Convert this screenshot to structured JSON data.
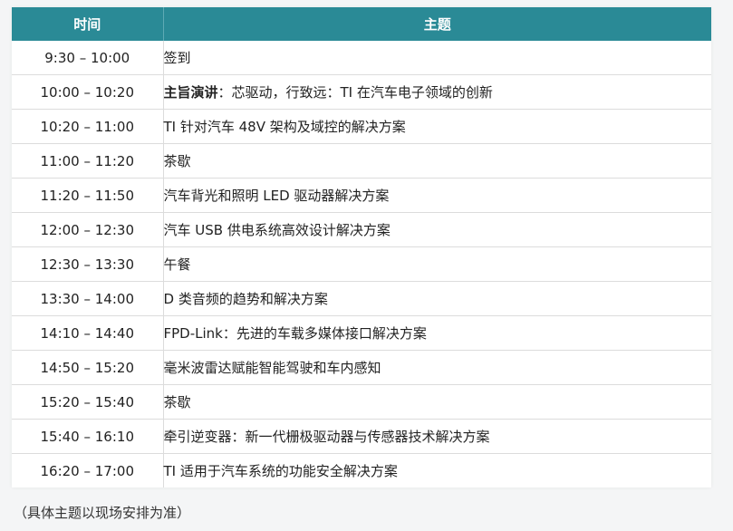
{
  "table": {
    "header": {
      "time": "时间",
      "topic": "主题"
    },
    "rows": [
      {
        "time": "9:30 – 10:00",
        "topic": "签到"
      },
      {
        "time": "10:00 – 10:20",
        "topic_bold": "主旨演讲",
        "topic": "：芯驱动，行致远：TI 在汽车电子领域的创新"
      },
      {
        "time": "10:20 – 11:00",
        "topic": "TI 针对汽车 48V 架构及域控的解决方案"
      },
      {
        "time": "11:00 – 11:20",
        "topic": "茶歇"
      },
      {
        "time": "11:20 – 11:50",
        "topic": "汽车背光和照明 LED 驱动器解决方案"
      },
      {
        "time": "12:00 – 12:30",
        "topic": "汽车 USB 供电系统高效设计解决方案"
      },
      {
        "time": "12:30 – 13:30",
        "topic": "午餐"
      },
      {
        "time": "13:30 – 14:00",
        "topic": "D 类音频的趋势和解决方案"
      },
      {
        "time": "14:10 – 14:40",
        "topic": "FPD-Link：先进的车载多媒体接口解决方案"
      },
      {
        "time": "14:50 – 15:20",
        "topic": "毫米波雷达赋能智能驾驶和车内感知"
      },
      {
        "time": "15:20 – 15:40",
        "topic": "茶歇"
      },
      {
        "time": "15:40 – 16:10",
        "topic": "牵引逆变器：新一代栅极驱动器与传感器技术解决方案"
      },
      {
        "time": "16:20 – 17:00",
        "topic": "TI 适用于汽车系统的功能安全解决方案"
      }
    ]
  },
  "note": "（具体主题以现场安排为准）",
  "colors": {
    "header_bg": "#2a8a96",
    "header_text": "#ffffff",
    "border": "#dcdcdc"
  }
}
